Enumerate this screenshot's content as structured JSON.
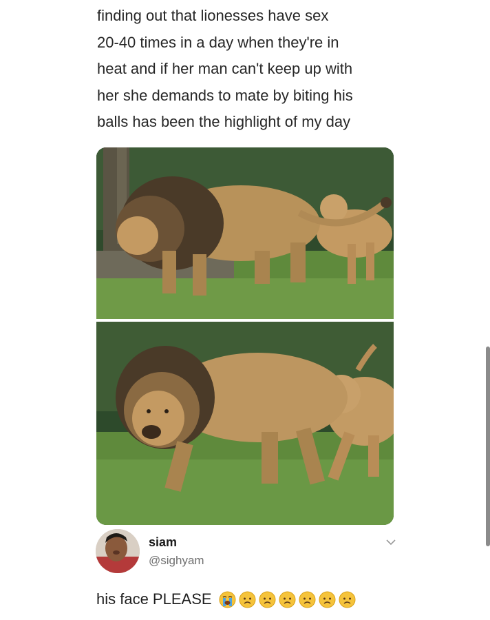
{
  "post": {
    "text": "finding out that lionesses have sex\n20-40 times in a day when they're in\nheat and if her man can't keep up with\nher she demands to mate by biting his\nballs has been the highlight of my day"
  },
  "reply": {
    "name": "siam",
    "handle": "@sighyam",
    "text": "his face PLEASE",
    "emojis": [
      "loudly-crying-face",
      "worried-face",
      "worried-face",
      "worried-face",
      "worried-face",
      "worried-face",
      "worried-face"
    ]
  },
  "colors": {
    "grass": "#5f8a3c",
    "lion": "#b8925a",
    "mane": "#4a3a28",
    "emoji": "#f5c33b"
  }
}
